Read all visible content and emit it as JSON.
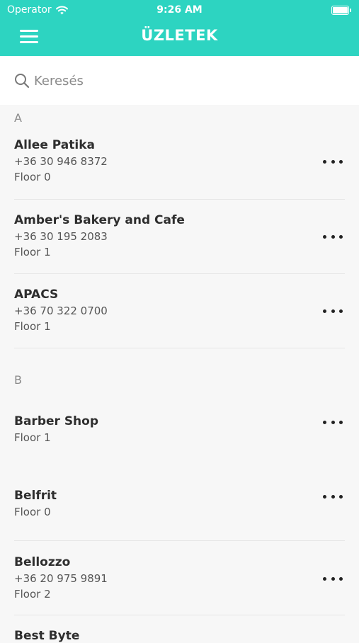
{
  "status_bar": {
    "carrier": "Operator",
    "time": "9:26 AM"
  },
  "header": {
    "title": "ÜZLETEK",
    "menu_icon": "hamburger-menu-icon"
  },
  "search": {
    "placeholder": "Keresés",
    "value": ""
  },
  "sections": [
    {
      "letter": "A",
      "stores": [
        {
          "name": "Allee Patika",
          "phone": "+36 30 946 8372",
          "floor": "Floor 0"
        },
        {
          "name": "Amber's Bakery and Cafe",
          "phone": "+36 30 195 2083",
          "floor": "Floor 1"
        },
        {
          "name": "APACS",
          "phone": "+36 70 322 0700",
          "floor": "Floor 1"
        }
      ]
    },
    {
      "letter": "B",
      "stores": [
        {
          "name": "Barber Shop",
          "floor": "Floor 1"
        },
        {
          "name": "Belfrit",
          "floor": "Floor 0"
        },
        {
          "name": "Bellozzo",
          "phone": "+36 20 975 9891",
          "floor": "Floor 2"
        },
        {
          "name": "Best Byte"
        }
      ]
    }
  ],
  "colors": {
    "header": "#2dd4c1",
    "background": "#f7f7f7"
  }
}
